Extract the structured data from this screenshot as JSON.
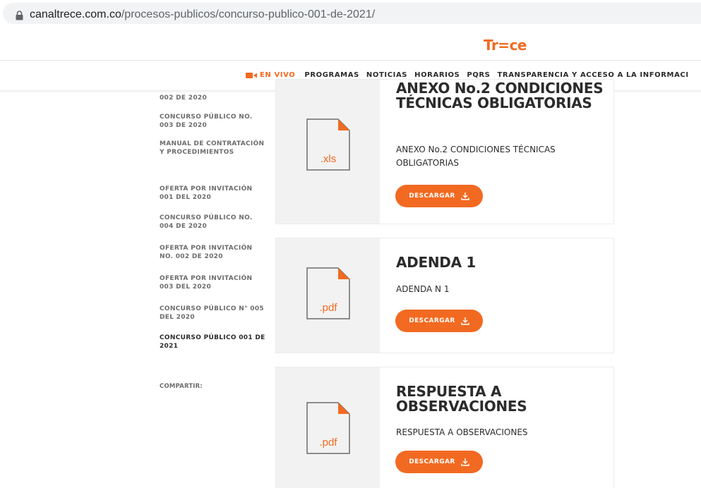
{
  "browser": {
    "url_host": "canaltrece.com.co",
    "url_path": "/procesos-publicos/concurso-publico-001-de-2021/"
  },
  "header": {
    "logo": "Tr=ce",
    "nav": {
      "live": "EN VIVO",
      "items": [
        "PROGRAMAS",
        "NOTICIAS",
        "HORARIOS",
        "PQRS",
        "TRANSPARENCIA Y ACCESO A LA INFORMACI"
      ]
    }
  },
  "sidebar": {
    "items": [
      {
        "label": "002 DE 2020"
      },
      {
        "label": "CONCURSO PÚBLICO NO. 003 DE 2020"
      },
      {
        "label": "MANUAL DE CONTRATACIÓN Y PROCEDIMIENTOS"
      },
      {
        "label": "OFERTA POR INVITACIÓN 001 DEL 2020"
      },
      {
        "label": "CONCURSO PÚBLICO NO. 004 DE 2020"
      },
      {
        "label": "OFERTA POR INVITACIÓN NO. 002 DE 2020"
      },
      {
        "label": "OFERTA POR INVITACIÓN 003 DEL 2020"
      },
      {
        "label": "CONCURSO PÚBLICO N° 005 DEL 2020"
      },
      {
        "label": "CONCURSO PÚBLICO 001 DE 2021",
        "active": true
      }
    ],
    "share_label": "COMPARTIR:"
  },
  "documents": [
    {
      "title": "ANEXO No.2 CONDICIONES TÉCNICAS OBLIGATORIAS",
      "description": "ANEXO No.2 CONDICIONES TÉCNICAS OBLIGATORIAS",
      "file_type": ".xls",
      "button_label": "DESCARGAR"
    },
    {
      "title": "ADENDA 1",
      "description": "ADENDA N 1",
      "file_type": ".pdf",
      "button_label": "DESCARGAR"
    },
    {
      "title": "RESPUESTA A OBSERVACIONES",
      "description": "RESPUESTA A OBSERVACIONES",
      "file_type": ".pdf",
      "button_label": "DESCARGAR"
    }
  ],
  "colors": {
    "accent": "#f26a21",
    "text": "#2b2b2b",
    "muted": "#6d6d6d",
    "thumb_bg": "#f2f2f2"
  },
  "icons": [
    "lock-icon",
    "video-camera-icon",
    "file-icon",
    "download-icon"
  ]
}
